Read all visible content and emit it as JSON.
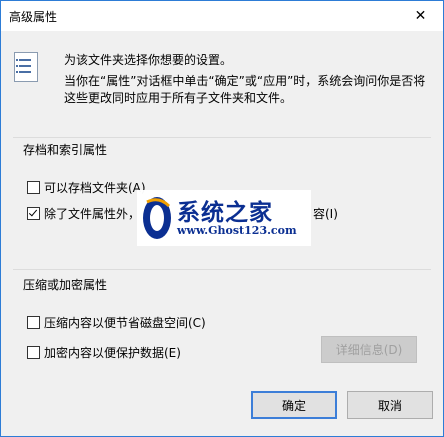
{
  "dialog": {
    "title": "高级属性",
    "close_glyph": "✕"
  },
  "intro": {
    "line1": "为该文件夹选择你想要的设置。",
    "line2": "当你在“属性”对话框中单击“确定”或“应用”时，系统会询问你是否将这些更改同时应用于所有子文件夹和文件。"
  },
  "archive_group": {
    "label": "存档和索引属性",
    "options": [
      {
        "label": "可以存档文件夹(A)",
        "checked": false
      },
      {
        "label": "除了文件属性外，",
        "label_tail": "容(I)",
        "checked": true
      }
    ]
  },
  "compress_group": {
    "label": "压缩或加密属性",
    "options": [
      {
        "label": "压缩内容以便节省磁盘空间(C)",
        "checked": false
      },
      {
        "label": "加密内容以便保护数据(E)",
        "checked": false
      }
    ],
    "details_button": "详细信息(D)"
  },
  "buttons": {
    "ok": "确定",
    "cancel": "取消"
  },
  "watermark": {
    "brand": "系统之家",
    "url": "www.Ghost123.com"
  },
  "colors": {
    "accent": "#3c7ed8",
    "watermark_blue": "#0b2f92"
  }
}
